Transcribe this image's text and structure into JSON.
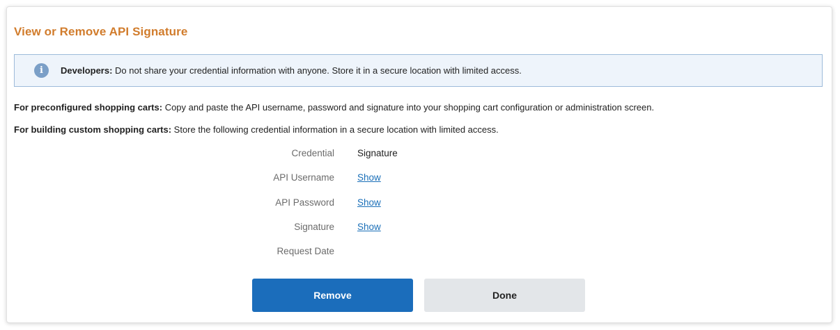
{
  "dialog": {
    "title": "View or Remove API Signature"
  },
  "notice": {
    "icon": "info-icon",
    "bold": "Developers:",
    "text": " Do not share your credential information with anyone. Store it in a secure location with limited access."
  },
  "instructions": [
    {
      "bold": "For preconfigured shopping carts:",
      "text": " Copy and paste the API username, password and signature into your shopping cart configuration or administration screen."
    },
    {
      "bold": "For building custom shopping carts:",
      "text": " Store the following credential information in a secure location with limited access."
    }
  ],
  "fields": [
    {
      "label": "Credential",
      "value": "Signature"
    },
    {
      "label": "API Username",
      "value": "Show"
    },
    {
      "label": "API Password",
      "value": "Show"
    },
    {
      "label": "Signature",
      "value": "Show"
    },
    {
      "label": "Request Date",
      "value": ""
    }
  ],
  "buttons": {
    "remove": "Remove",
    "done": "Done"
  },
  "colors": {
    "title": "#d17c2c",
    "link": "#1a6fb8",
    "primary": "#1b6dbb",
    "secondary": "#e3e6e9",
    "notice_bg": "#eef4fb",
    "notice_border": "#9dbbda"
  }
}
